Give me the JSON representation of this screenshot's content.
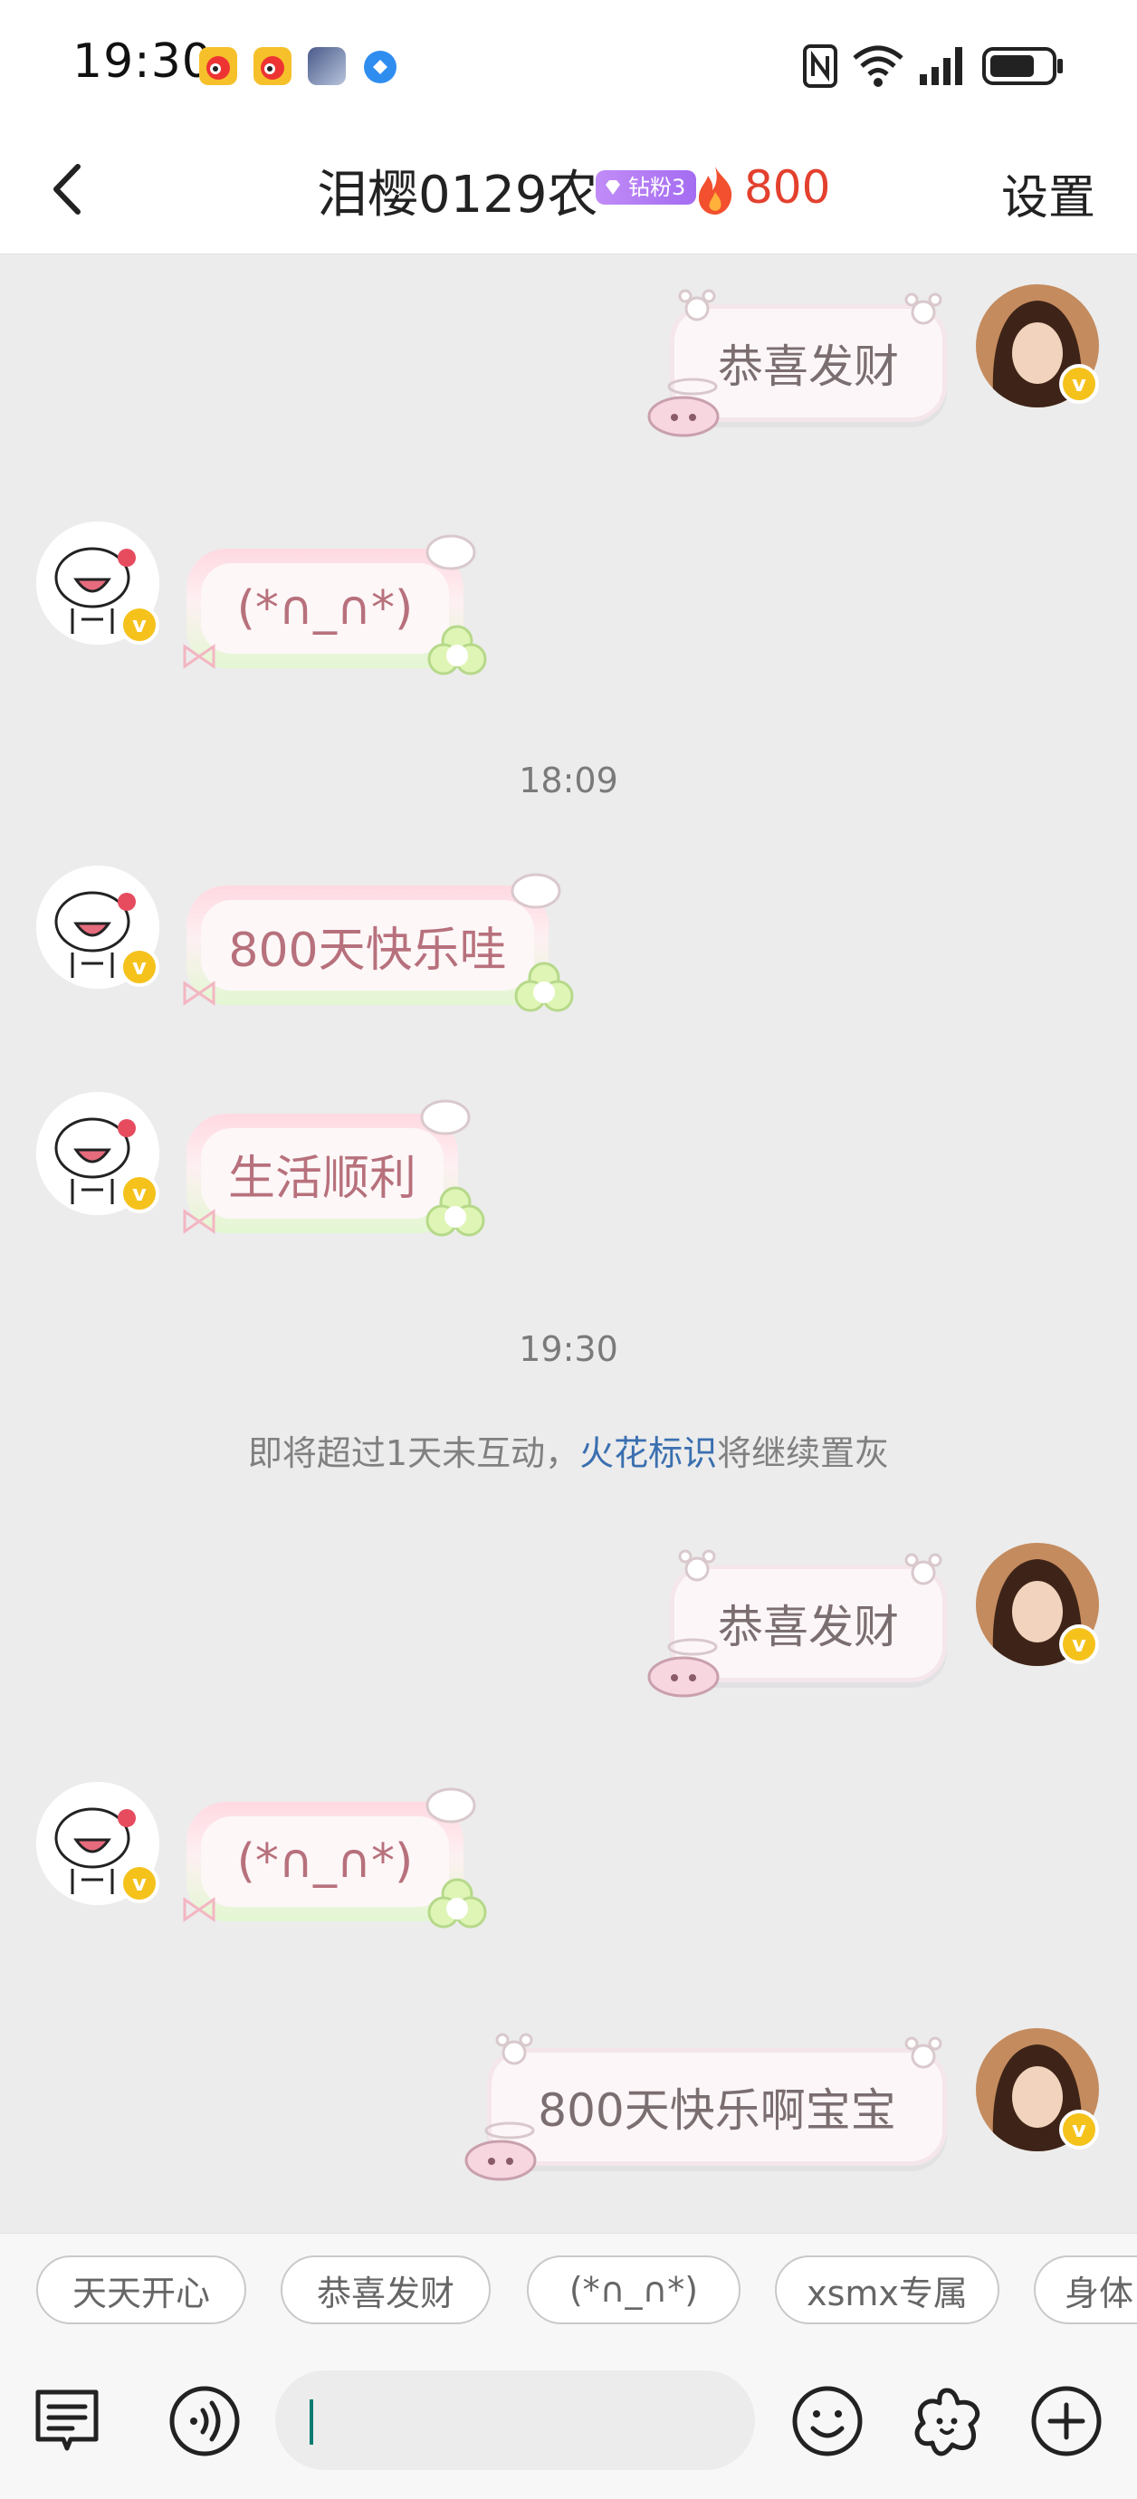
{
  "status_bar": {
    "time": "19:30",
    "app_icons": [
      "weibo-icon",
      "weibo-icon",
      "game-avatar-icon",
      "browser-icon"
    ],
    "system_icons": [
      "nfc-icon",
      "wifi-icon",
      "signal-icon",
      "battery-icon"
    ]
  },
  "header": {
    "back_icon": "chevron-left-icon",
    "title": "泪樱0129农",
    "fan_badge": "钻粉3",
    "streak_icon": "fire-icon",
    "streak_count": "800",
    "settings_label": "设置"
  },
  "messages": [
    {
      "side": "right",
      "text": "恭喜发财"
    },
    {
      "side": "left",
      "text": "(*∩_∩*)"
    },
    {
      "type": "timestamp",
      "text": "18:09"
    },
    {
      "side": "left",
      "text": "800天快乐哇"
    },
    {
      "side": "left",
      "text": "生活顺利"
    },
    {
      "type": "timestamp",
      "text": "19:30"
    },
    {
      "type": "notice",
      "prefix": "即将超过1天未互动，",
      "link": "火花标识",
      "suffix": "将继续置灰"
    },
    {
      "side": "right",
      "text": "恭喜发财"
    },
    {
      "side": "left",
      "text": "(*∩_∩*)"
    },
    {
      "side": "right",
      "text": "800天快乐啊宝宝"
    }
  ],
  "quick_replies": [
    "天天开心",
    "恭喜发财",
    "(*∩_∩*)",
    "xsmx专属",
    "身体"
  ],
  "toolbar": {
    "icons": [
      "message-list-icon",
      "voice-icon",
      "emoji-icon",
      "sticker-flower-icon",
      "plus-icon"
    ],
    "input_placeholder": ""
  },
  "colors": {
    "streak": "#e3402e",
    "badge": "#a46cf1",
    "verified": "#f5c21c",
    "link": "#3a6fb0"
  }
}
